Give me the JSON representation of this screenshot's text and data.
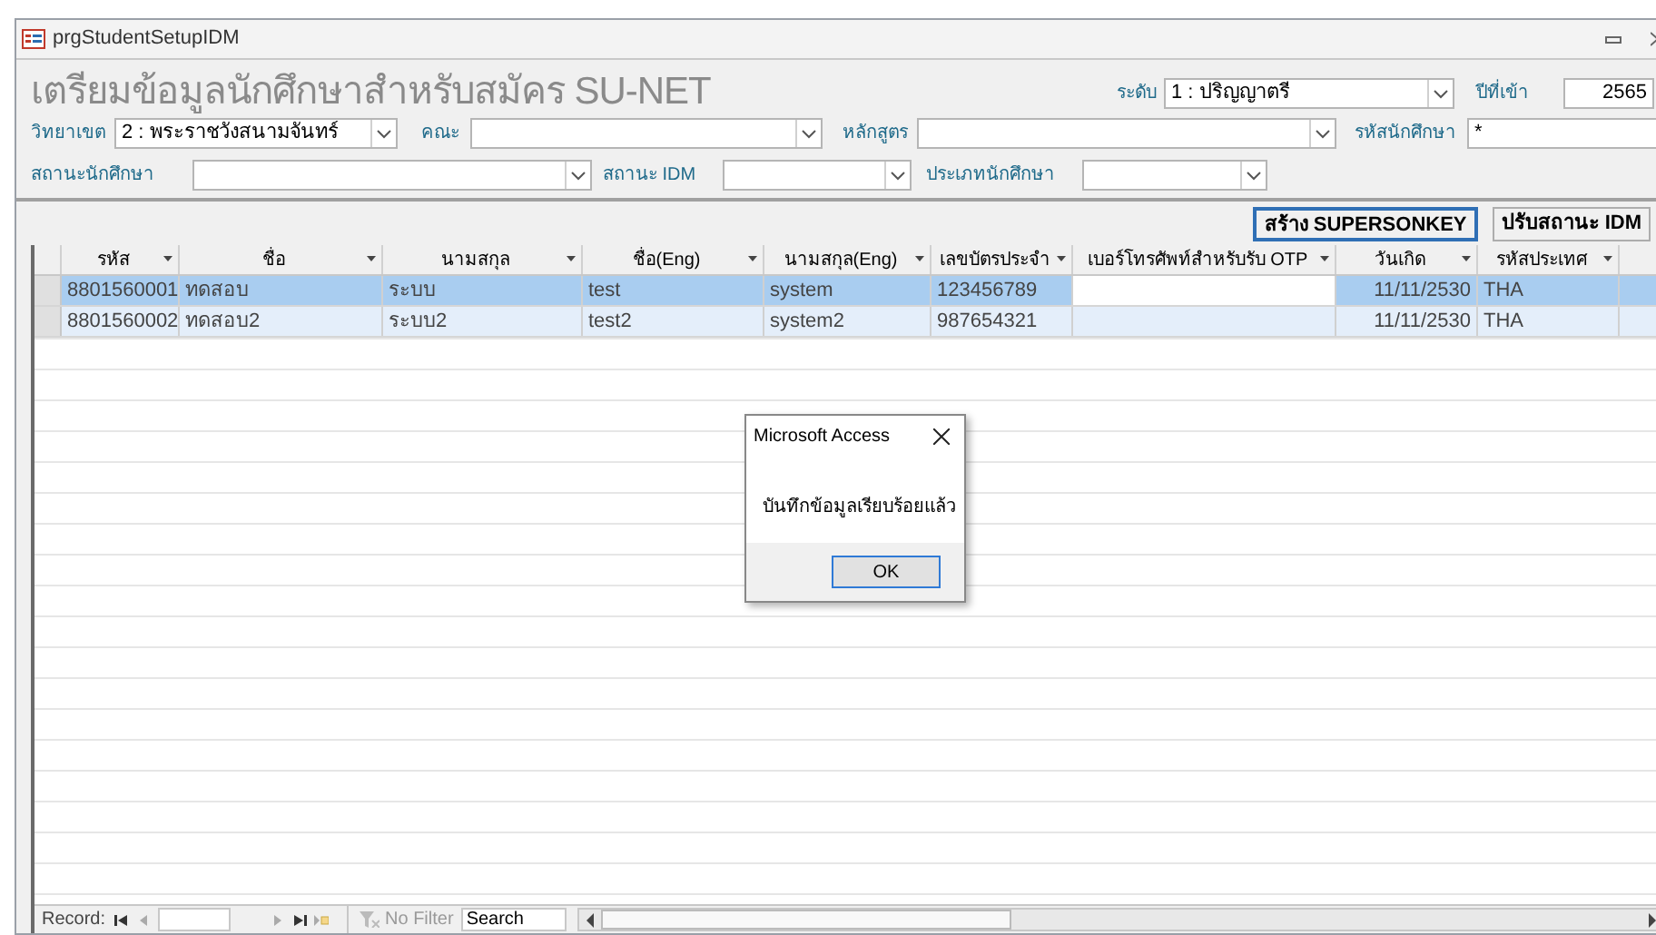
{
  "window": {
    "title": "prgStudentSetupIDM"
  },
  "form_title": "เตรียมข้อมูลนักศึกษาสำหรับสมัคร SU-NET",
  "filter_rows": [
    [
      {
        "label": "ระดับ",
        "kind": "combo",
        "value": "1 : ปริญญาตรี"
      },
      {
        "label": "ปีที่เข้า",
        "kind": "text",
        "value": "2565"
      }
    ],
    [
      {
        "label": "วิทยาเขต",
        "kind": "combo",
        "value": "2 : พระราชวังสนามจันทร์"
      },
      {
        "label": "คณะ",
        "kind": "combo"
      },
      {
        "label": "หลักสูตร",
        "kind": "combo"
      },
      {
        "label": "รหัสนักศึกษา",
        "kind": "text",
        "value": "*"
      }
    ],
    [
      {
        "label": "สถานะนักศึกษา",
        "kind": "combo"
      },
      {
        "label": "สถานะ IDM",
        "kind": "combo"
      },
      {
        "label": "ประเภทนักศึกษา",
        "kind": "combo"
      }
    ]
  ],
  "buttons": [
    {
      "label": "สร้าง SUPERSONKEY",
      "focused": true
    },
    {
      "label": "ปรับสถานะ IDM",
      "focused": false
    }
  ],
  "table": {
    "columns": [
      "รหัส",
      "ชื่อ",
      "นามสกุล",
      "ชื่อ(Eng)",
      "นามสกุล(Eng)",
      "เลขบัตรประจำ",
      "เบอร์โทรศัพท์สำหรับรับ OTP",
      "วันเกิด",
      "รหัสประเทศ"
    ],
    "rows": [
      {
        "selected": true,
        "cells": [
          "8801560001",
          "ทดสอบ",
          "ระบบ",
          "test",
          "system",
          "123456789",
          "",
          "11/11/2530",
          "THA"
        ]
      },
      {
        "selected": false,
        "cells": [
          "8801560002",
          "ทดสอบ2",
          "ระบบ2",
          "test2",
          "system2",
          "987654321",
          "",
          "11/11/2530",
          "THA"
        ]
      }
    ]
  },
  "dialog": {
    "title": "Microsoft Access",
    "message": "บันทึกข้อมูลเรียบร้อยแล้ว",
    "button": "OK"
  },
  "navigation": {
    "label": "Record:",
    "filter": "No Filter",
    "search_placeholder": "Search"
  }
}
